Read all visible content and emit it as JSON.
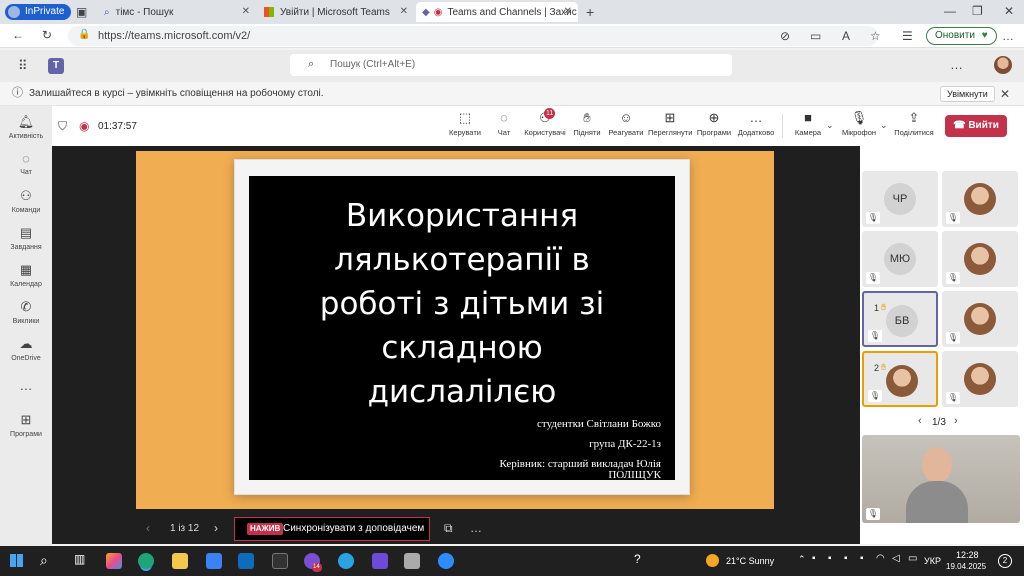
{
  "browser": {
    "inprivate_label": "InPrivate",
    "tabs": [
      {
        "label": "тімс - Пошук"
      },
      {
        "label": "Увійти | Microsoft Teams"
      },
      {
        "label": "Teams and Channels | Захис"
      }
    ],
    "url": "https://teams.microsoft.com/v2/",
    "update_label": "Оновити"
  },
  "teams": {
    "search_placeholder": "Пошук (Ctrl+Alt+E)",
    "notification": "Залишайтеся в курсі – увімкніть сповіщення на робочому столі.",
    "notification_button": "Увімкнути",
    "rail": [
      {
        "label": "Активність",
        "icon": "bell-icon"
      },
      {
        "label": "Чат",
        "icon": "chat-icon"
      },
      {
        "label": "Команди",
        "icon": "teams-icon"
      },
      {
        "label": "Завдання",
        "icon": "assignments-icon"
      },
      {
        "label": "Календар",
        "icon": "calendar-icon"
      },
      {
        "label": "Виклики",
        "icon": "phone-icon"
      },
      {
        "label": "OneDrive",
        "icon": "cloud-icon"
      },
      {
        "label": "Програми",
        "icon": "apps-icon"
      }
    ],
    "meeting": {
      "timer": "01:37:57",
      "participants_badge": "11",
      "tools": [
        {
          "label": "Керувати",
          "icon": "manage-icon"
        },
        {
          "label": "Чат",
          "icon": "chat-icon"
        },
        {
          "label": "Користувачі",
          "icon": "people-icon"
        },
        {
          "label": "Підняти",
          "icon": "raise-hand-icon"
        },
        {
          "label": "Реагувати",
          "icon": "react-icon"
        },
        {
          "label": "Переглянути",
          "icon": "view-icon"
        },
        {
          "label": "Програми",
          "icon": "add-app-icon"
        },
        {
          "label": "Додатково",
          "icon": "more-icon"
        },
        {
          "label": "Камера",
          "icon": "camera-icon"
        },
        {
          "label": "Мікрофон",
          "icon": "mic-icon"
        },
        {
          "label": "Поділитися",
          "icon": "share-icon"
        }
      ],
      "leave_label": "Вийти"
    },
    "slide": {
      "title_lines": [
        "Використання",
        "лялькотерапії в",
        "роботі з дітьми зі",
        "складною",
        "дислалілєю"
      ],
      "credits": [
        "студентки Світлани  Божко",
        "група ДК-22-1з",
        "Керівник: старший викладач Юлія",
        "ПОЛІЩУК"
      ]
    },
    "stage_controls": {
      "page": "1 із 12",
      "live_badge": "НАЖИВ",
      "sync_label": "Синхронізувати з доповідачем"
    },
    "participants": {
      "tiles": [
        {
          "initials": "ЧР"
        },
        {
          "initials": "МЮ"
        },
        {
          "initials": "БВ",
          "raised": "1"
        },
        {
          "raised": "2"
        }
      ],
      "pager": "1/3"
    }
  },
  "taskbar": {
    "weather": "21°C  Sunny",
    "lang": "УКР",
    "time": "12:28",
    "date": "19.04.2025",
    "notifications": "2",
    "app_badge": "14"
  }
}
